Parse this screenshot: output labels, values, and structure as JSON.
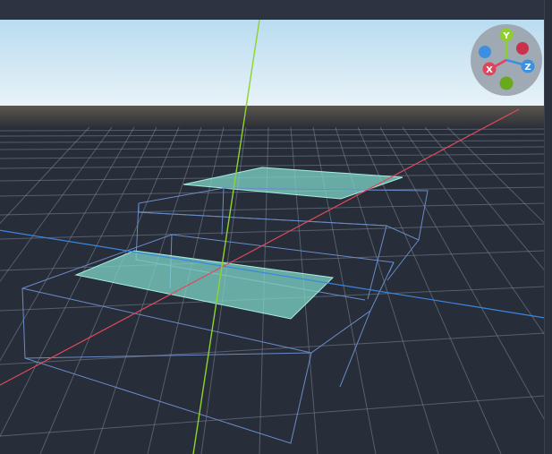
{
  "editor": {
    "viewport": {
      "gizmo": {
        "x_label": "X",
        "y_label": "Y",
        "z_label": "Z",
        "x_color": "#e0435a",
        "y_color": "#8fcf2a",
        "z_color": "#3d8fe0"
      },
      "colors": {
        "sky_top": "#bfe0f2",
        "sky_bottom": "#e6f1f7",
        "ground": "#2a303c",
        "grid": "#8a93a3",
        "x_axis": "#e04a5a",
        "y_axis": "#8ed42a",
        "z_axis": "#3a86e0",
        "plane_fill": "#7fd6c8",
        "wireframe": "#6a8cc8"
      }
    }
  }
}
